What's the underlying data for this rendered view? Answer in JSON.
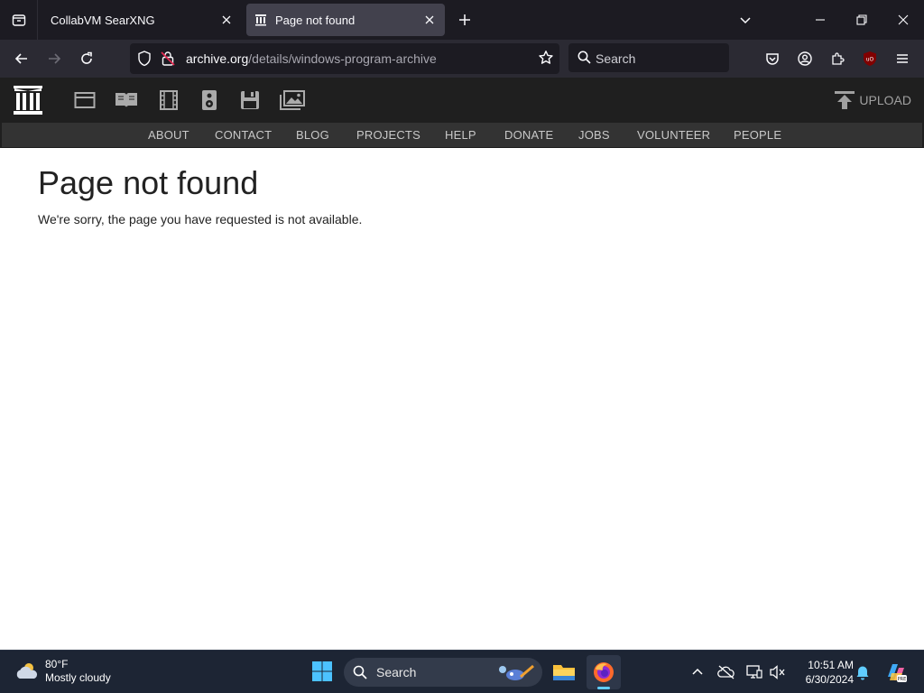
{
  "browser": {
    "tabs": [
      {
        "title": "CollabVM SearXNG",
        "active": false
      },
      {
        "title": "Page not found",
        "active": true
      }
    ],
    "url_host": "archive.org",
    "url_path": "/details/windows-program-archive",
    "search_placeholder": "Search"
  },
  "archive_header": {
    "upload_label": "UPLOAD",
    "media_icons": [
      "web-icon",
      "texts-icon",
      "video-icon",
      "audio-icon",
      "software-icon",
      "images-icon"
    ],
    "nav": [
      "ABOUT",
      "CONTACT",
      "BLOG",
      "PROJECTS",
      "HELP",
      "DONATE",
      "JOBS",
      "VOLUNTEER",
      "PEOPLE"
    ]
  },
  "page": {
    "title": "Page not found",
    "message": "We're sorry, the page you have requested is not available."
  },
  "taskbar": {
    "weather_temp": "80°F",
    "weather_condition": "Mostly cloudy",
    "search_label": "Search",
    "time": "10:51 AM",
    "date": "6/30/2024"
  },
  "colors": {
    "tab_bar": "#1c1b22",
    "nav_bar": "#2b2a33",
    "active_tab": "#42414d",
    "ia_header": "#1f1f1f",
    "ia_nav": "#333333",
    "taskbar": "#1d2534"
  }
}
